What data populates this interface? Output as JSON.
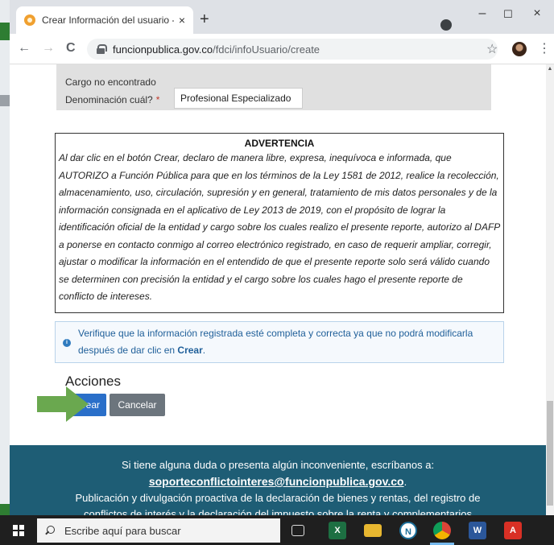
{
  "browser": {
    "tab_title": "Crear Información del usuario - S",
    "tab_close": "×",
    "new_tab": "+",
    "url_host": "funcionpublica.gov.co",
    "url_path": "/fdci/infoUsuario/create",
    "back": "←",
    "forward": "→",
    "reload": "C",
    "star": "☆",
    "menu": "⋮",
    "minimize": "–",
    "maximize": "☐",
    "close": "×"
  },
  "form": {
    "cargo_message": "Cargo no encontrado",
    "denomination_label": "Denominación cuál?",
    "required_mark": "*",
    "denomination_value": "Profesional Especializado"
  },
  "warning": {
    "title": "ADVERTENCIA",
    "text": "Al dar clic en el botón Crear, declaro de manera libre, expresa, inequívoca e informada, que AUTORIZO a Función Pública para que en los términos de la Ley 1581 de 2012, realice la recolección, almacenamiento, uso, circulación, supresión y en general, tratamiento de mis datos personales y de la información consignada en el aplicativo de Ley 2013 de 2019, con el propósito de lograr la identificación oficial de la entidad y cargo sobre los cuales realizo el presente reporte, autorizo al DAFP a ponerse en contacto conmigo al correo electrónico registrado, en caso de requerir ampliar, corregir, ajustar o modificar la información en el entendido de que el presente reporte solo será válido cuando se determinen con precisión la entidad y el cargo sobre los cuales hago el presente reporte de conflicto de intereses."
  },
  "info": {
    "text_before": "Verifique que la información registrada esté completa y correcta ya que no podrá modificarla después de dar clic en ",
    "text_bold": "Crear",
    "text_after": "."
  },
  "actions": {
    "heading": "Acciones",
    "create_label": "rear",
    "cancel_label": "Cancelar"
  },
  "footer": {
    "line1": "Si tiene alguna duda o presenta algún inconveniente, escríbanos a:",
    "email": "soporteconflictointeres@funcionpublica.gov.co",
    "email_suffix": ".",
    "line3": "Publicación y divulgación proactiva de la declaración de bienes y rentas, del registro de",
    "line4": "conflictos de interés y la declaración del impuesto sobre la renta y complementarios"
  },
  "taskbar": {
    "search_placeholder": "Escribe aquí para buscar"
  },
  "colors": {
    "primary_button": "#2a6fc9",
    "secondary_button": "#6c757d",
    "footer_bg": "#1e5d75",
    "arrow": "#6aa84f"
  }
}
